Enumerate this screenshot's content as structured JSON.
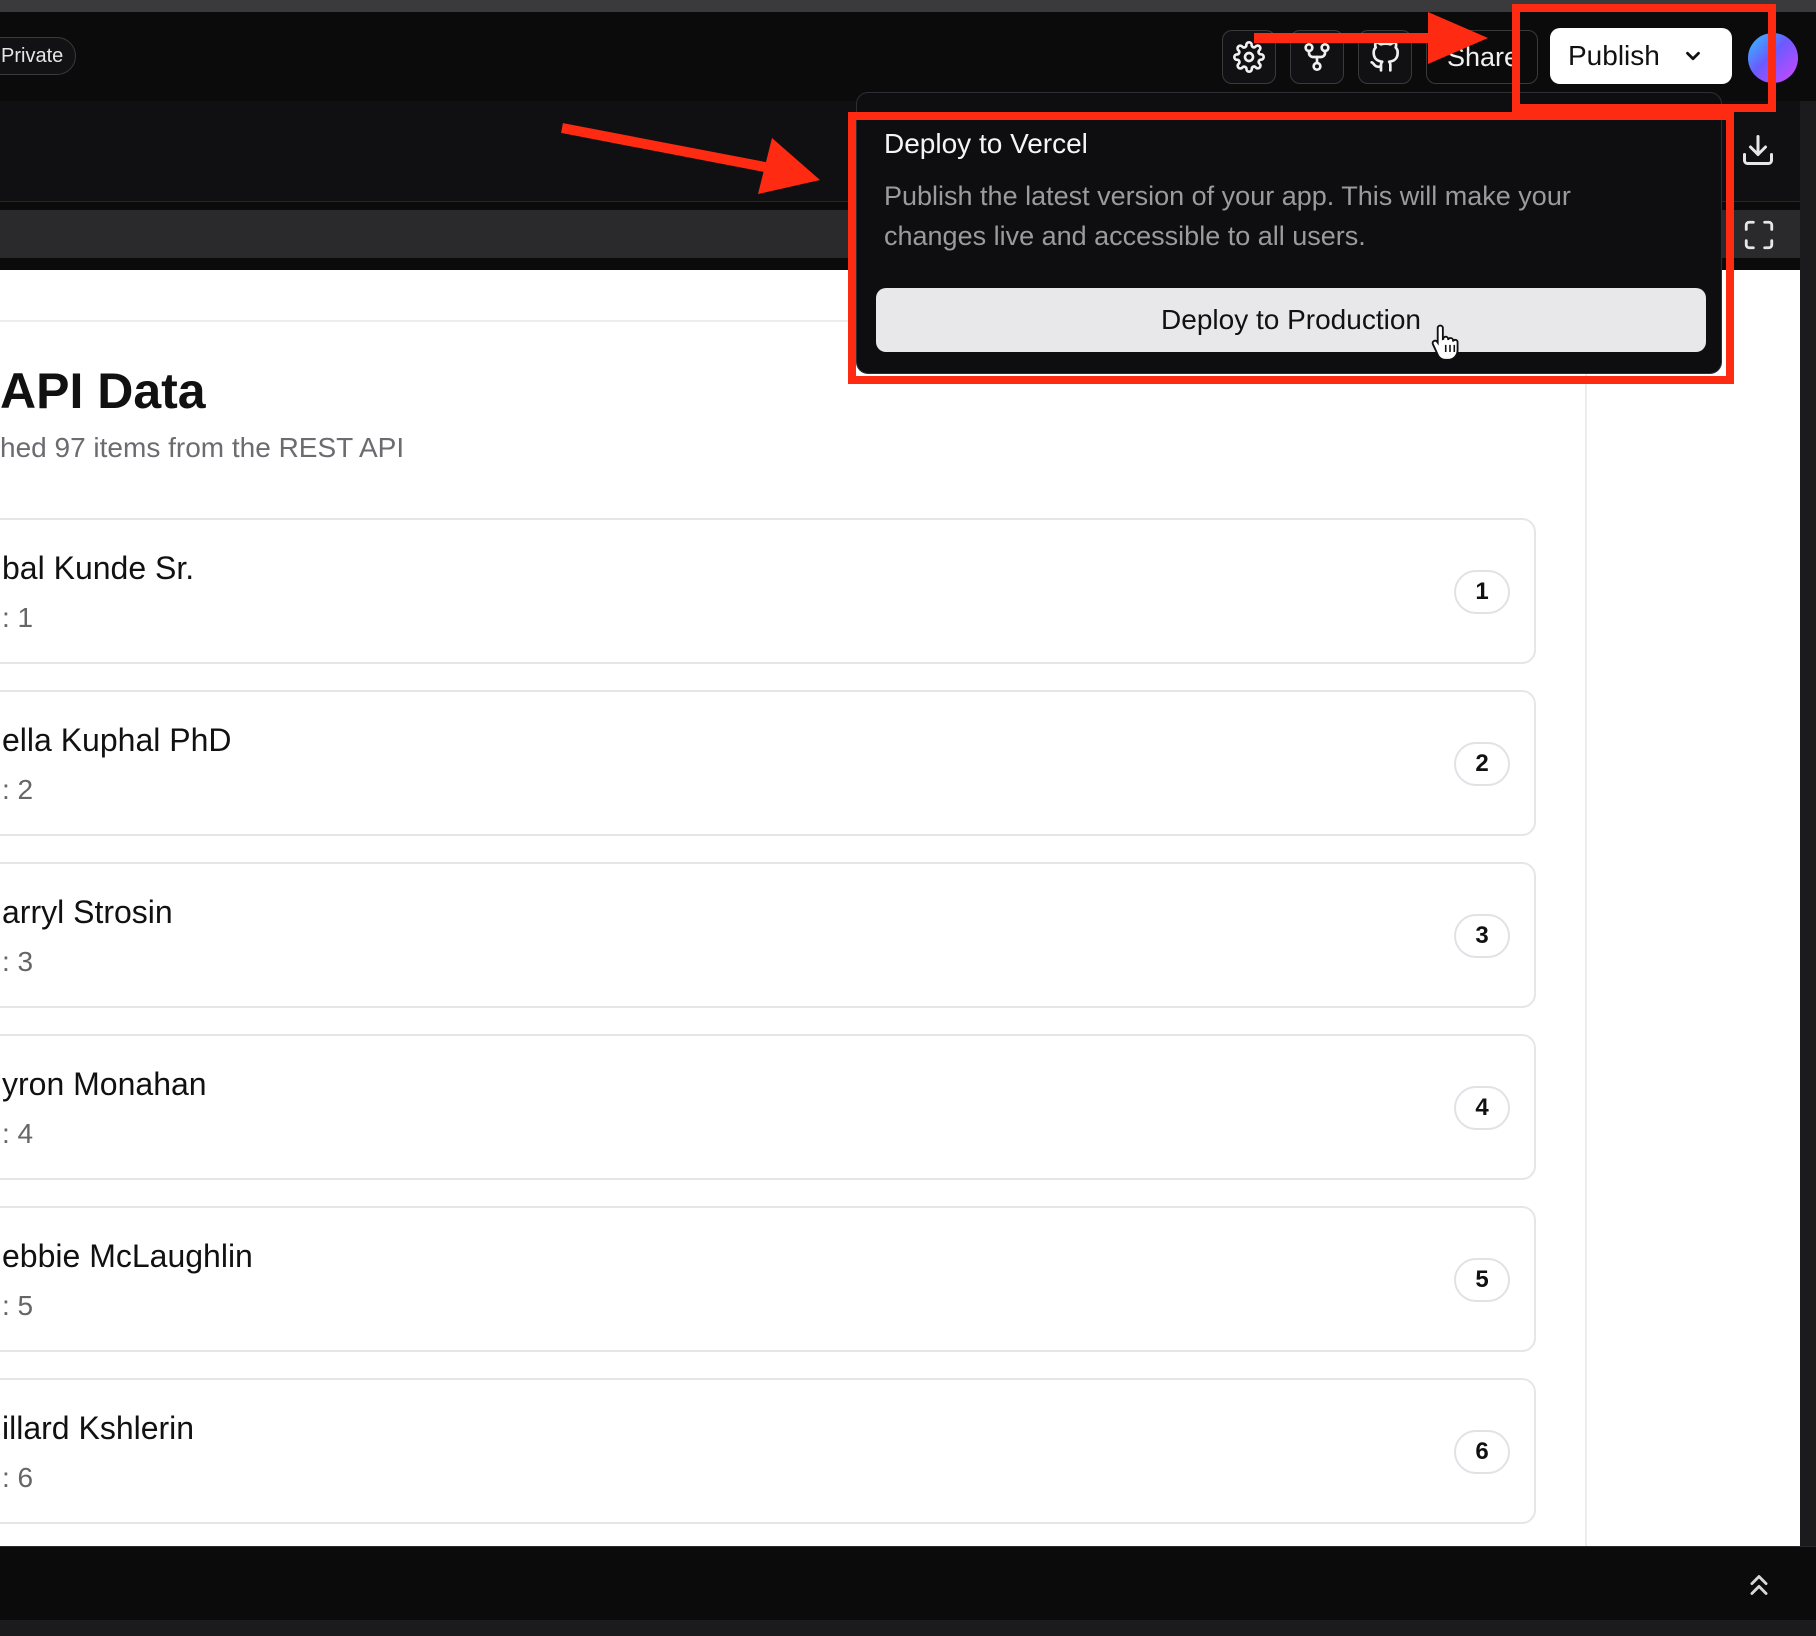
{
  "header": {
    "privacy_badge": "Private",
    "share_label": "Share",
    "publish_label": "Publish"
  },
  "popover": {
    "title": "Deploy to Vercel",
    "description": "Publish the latest version of your app. This will make your changes live and accessible to all users.",
    "deploy_button": "Deploy to Production"
  },
  "content": {
    "title": "API Data",
    "subtitle": "hed 97 items from the REST API",
    "items": [
      {
        "name": "bal Kunde Sr.",
        "id_text": ": 1",
        "badge": "1"
      },
      {
        "name": "ella Kuphal PhD",
        "id_text": ": 2",
        "badge": "2"
      },
      {
        "name": "arryl Strosin",
        "id_text": ": 3",
        "badge": "3"
      },
      {
        "name": "yron Monahan",
        "id_text": ": 4",
        "badge": "4"
      },
      {
        "name": "ebbie McLaughlin",
        "id_text": ": 5",
        "badge": "5"
      },
      {
        "name": "illard Kshlerin",
        "id_text": ": 6",
        "badge": "6"
      }
    ]
  },
  "icons": {
    "settings": "gear-icon",
    "branch": "git-branch-icon",
    "github": "github-icon",
    "chevron": "chevron-down-icon",
    "download": "download-icon",
    "fullscreen": "fullscreen-icon",
    "scroll_up": "double-chevron-up-icon",
    "cursor": "hand-pointer-icon"
  },
  "colors": {
    "annotation": "#ff2a12",
    "publish_button": "#ffffff",
    "background": "#0b0b0c"
  }
}
